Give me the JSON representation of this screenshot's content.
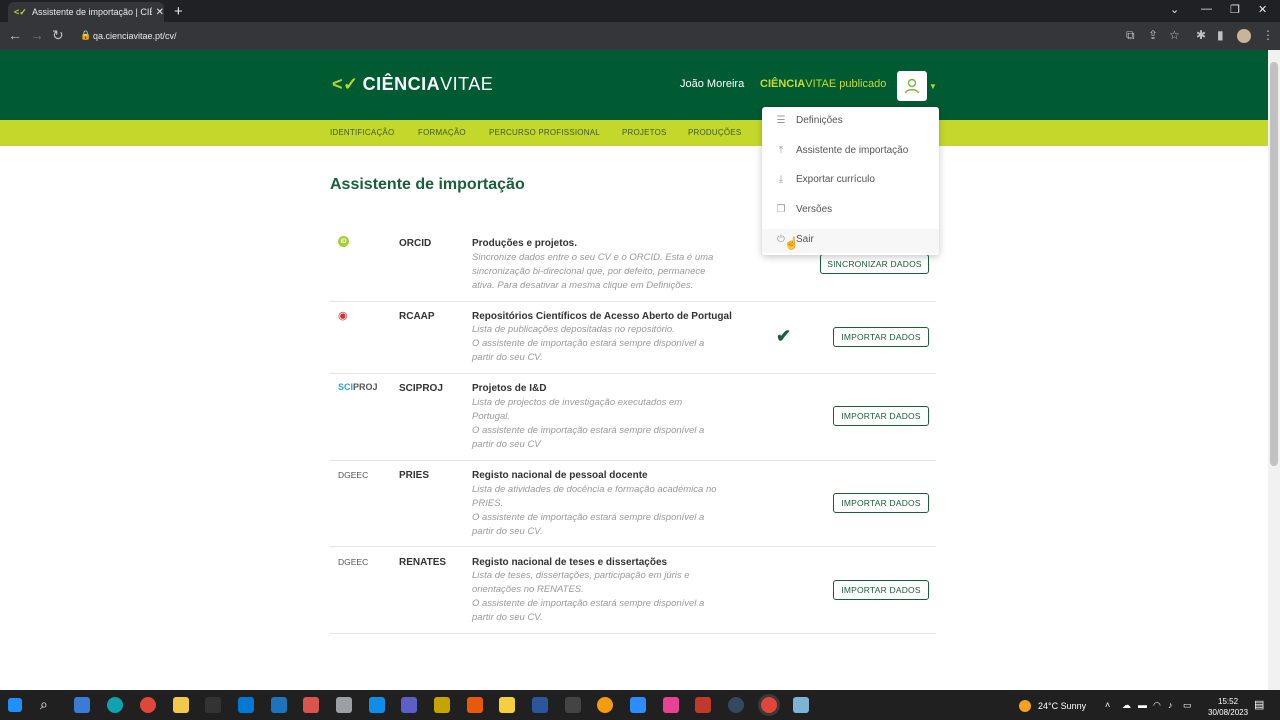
{
  "browser": {
    "tab_title": "Assistente de importação | CIÊNC",
    "url": "qa.cienciavitae.pt/cv/",
    "window_buttons": [
      "minimize-icon",
      "maximize-icon",
      "close-icon"
    ]
  },
  "header": {
    "logo_text_bold": "CIÊNCIA",
    "logo_text_light": "VITAE",
    "user_name": "João Moreira",
    "cv_status_bold": "CIÊNCIA",
    "cv_status_rest": "VITAE publicado"
  },
  "nav": {
    "items": [
      "IDENTIFICAÇÃO",
      "FORMAÇÃO",
      "PERCURSO PROFISSIONAL",
      "PROJETOS",
      "PRODUÇÕES"
    ]
  },
  "page": {
    "title": "Assistente de importação"
  },
  "rows": [
    {
      "source": "ORCID",
      "icon_text": "iD",
      "title": "Produções e projetos.",
      "desc": [
        "Sincronize dados entre o seu CV e o ORCID. Esta é uma",
        "sincronização bi-direcional que, por defeito, permanece",
        "ativa. Para desativar a mesma clique em Definições."
      ],
      "button": "SINCRONIZAR DADOS"
    },
    {
      "source": "RCAAP",
      "icon_text": "◉",
      "title": "Repositórios Científicos de Acesso Aberto de Portugal",
      "desc": [
        "Lista de publicações depositadas no repositório.",
        "O assistente de importação estará sempre disponível a",
        "partir do seu CV."
      ],
      "button": "IMPORTAR DADOS"
    },
    {
      "source": "SCIPROJ",
      "icon_text_a": "SCI",
      "icon_text_b": "PROJ",
      "title": "Projetos de I&D",
      "desc": [
        "Lista de projectos de investigação executados em",
        "Portugal.",
        "O assistente de importação estará sempre disponível a",
        "partir do seu CV"
      ],
      "button": "IMPORTAR DADOS"
    },
    {
      "source": "PRIES",
      "icon_text": "DGEEC",
      "title": "Registo nacional de pessoal docente",
      "desc": [
        "Lista de atividades de docência e formação académica no",
        "PRIES.",
        "O assistente de importação estará sempre disponível a",
        "partir do seu CV."
      ],
      "button": "IMPORTAR DADOS"
    },
    {
      "source": "RENATES",
      "icon_text": "DGEEC",
      "title": "Registo nacional de teses e dissertações",
      "desc": [
        "Lista de teses, dissertações, participação em júris e",
        "orientações no RENATES.",
        "O assistente de importação estará sempre disponível a",
        "partir do seu CV."
      ],
      "button": "IMPORTAR DADOS"
    }
  ],
  "dropdown": {
    "items": [
      {
        "label": "Definições",
        "icon": "sliders-icon"
      },
      {
        "label": "Assistente de importação",
        "icon": "upload-icon"
      },
      {
        "label": "Exportar currículo",
        "icon": "download-icon"
      },
      {
        "label": "Versões",
        "icon": "copy-icon"
      },
      {
        "label": "Sair",
        "icon": "power-icon"
      }
    ]
  },
  "taskbar": {
    "weather": "24°C  Sunny",
    "time": "15:52",
    "date": "30/08/2023"
  },
  "colors": {
    "header_green": "#005a32",
    "nav_lime": "#c4d82c",
    "accent_green": "#1b5e3a"
  }
}
